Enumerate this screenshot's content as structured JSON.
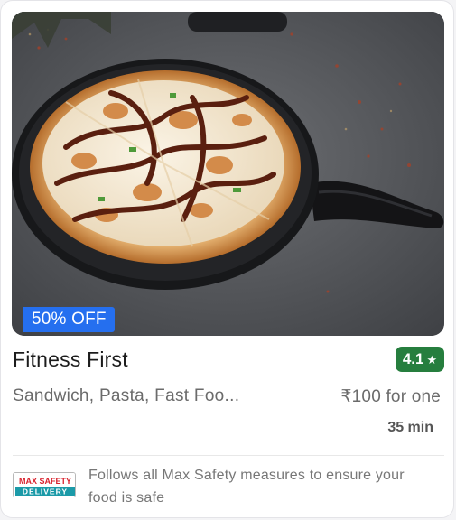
{
  "restaurant": {
    "name": "Fitness First",
    "rating": "4.1",
    "rating_icon": "star-icon",
    "cuisines": "Sandwich, Pasta, Fast Foo...",
    "cost": "₹100 for one",
    "delivery_time": "35 min"
  },
  "offer": {
    "label": "50% OFF",
    "color": "#256fef"
  },
  "safety": {
    "logo_line1": "MAX SAFETY",
    "logo_line2": "DELIVERY",
    "message": "Follows all Max Safety measures to ensure your food is safe"
  },
  "colors": {
    "rating_bg": "#267e3e",
    "safety_logo_red": "#d9232e",
    "safety_logo_teal": "#1b9aa8"
  }
}
